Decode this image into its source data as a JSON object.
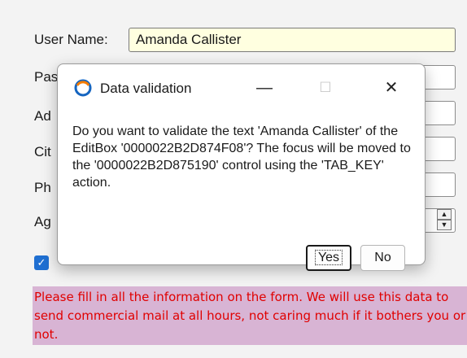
{
  "form": {
    "labels": {
      "username": "User Name:",
      "password_partial": "Pas",
      "address_partial": "Ad",
      "city_partial": "Cit",
      "phone_partial": "Ph",
      "age_partial": "Ag"
    },
    "username_value": "Amanda Callister",
    "checkbox_checked": true,
    "disclaimer": "Please fill in all the information on the form. We will use this data to send commercial mail at all hours, not caring much if it bothers you or not."
  },
  "dialog": {
    "title": "Data validation",
    "message": "Do you want to validate the text 'Amanda Callister' of the EditBox '0000022B2D874F08'? The focus will be moved to the '0000022B2D875190' control using the 'TAB_KEY' action.",
    "yes_label": "Yes",
    "no_label": "No",
    "minimize_glyph": "—",
    "maximize_glyph": "☐",
    "close_glyph": "✕"
  },
  "icons": {
    "app": "app-logo-icon",
    "spin_up": "▲",
    "spin_down": "▼",
    "check": "✓"
  },
  "colors": {
    "accent": "#1f6fd1",
    "disclaimer_bg": "#d8b4d4",
    "disclaimer_text": "#e00000",
    "username_bg": "#ffffe0"
  }
}
